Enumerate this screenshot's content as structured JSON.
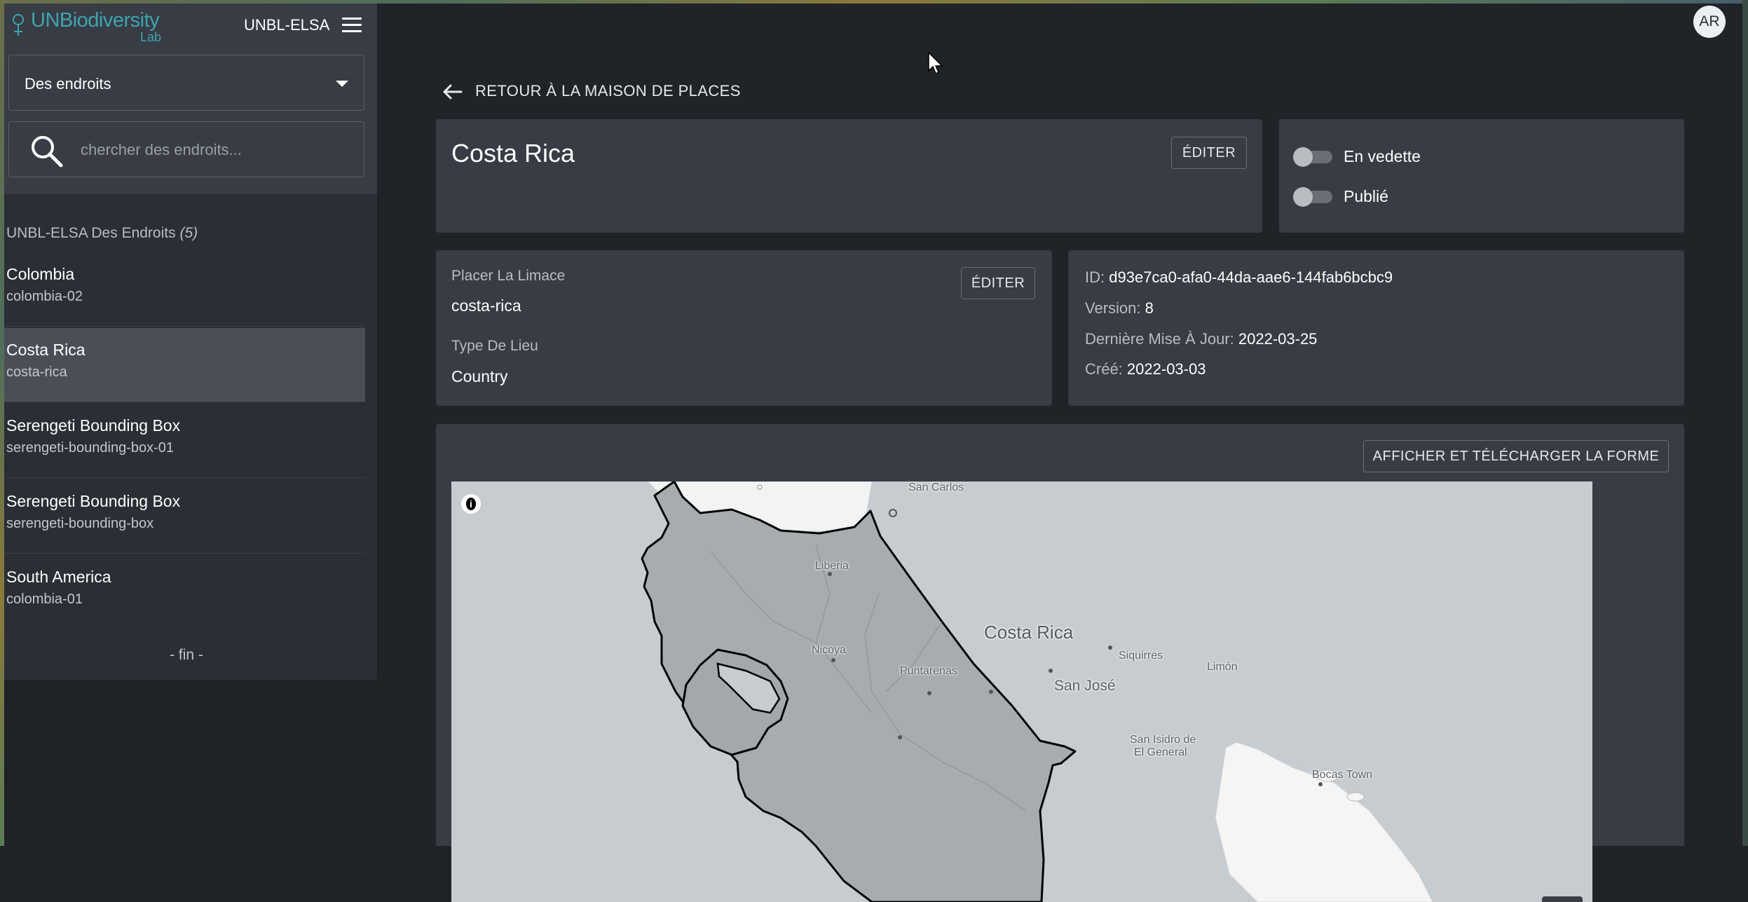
{
  "app": {
    "logo_text": "UNBiodiversity",
    "logo_sub": "Lab",
    "instance_name": "UNBL-ELSA",
    "avatar_initials": "AR",
    "accent_color": "#3fa5b0"
  },
  "sidebar": {
    "select_value": "Des endroits",
    "search_placeholder": "chercher des endroits...",
    "list_title": "UNBL-ELSA Des Endroits",
    "list_count": "(5)",
    "items": [
      {
        "title": "Colombia",
        "slug": "colombia-02",
        "active": false
      },
      {
        "title": "Costa Rica",
        "slug": "costa-rica",
        "active": true
      },
      {
        "title": "Serengeti Bounding Box",
        "slug": "serengeti-bounding-box-01",
        "active": false
      },
      {
        "title": "Serengeti Bounding Box",
        "slug": "serengeti-bounding-box",
        "active": false
      },
      {
        "title": "South America",
        "slug": "colombia-01",
        "active": false
      }
    ],
    "end_label": "- fin -"
  },
  "main": {
    "back_label": "RETOUR À LA MAISON DE PLACES",
    "place_title": "Costa Rica",
    "edit_label": "ÉDITER",
    "toggles": [
      {
        "label": "En vedette",
        "on": false
      },
      {
        "label": "Publié",
        "on": false
      }
    ],
    "slug_label": "Placer La Limace",
    "slug_value": "costa-rica",
    "type_label": "Type De Lieu",
    "type_value": "Country",
    "meta": {
      "id_label": "ID:",
      "id_value": "d93e7ca0-afa0-44da-aae6-144fab6bcbc9",
      "version_label": "Version:",
      "version_value": "8",
      "updated_label": "Dernière Mise À Jour:",
      "updated_value": "2022-03-25",
      "created_label": "Créé:",
      "created_value": "2022-03-03"
    },
    "shape_button": "AFFICHER ET TÉLÉCHARGER LA FORME",
    "map": {
      "country_label": "Costa Rica",
      "capital_label": "San José",
      "places": [
        "San Carlos",
        "Liberia",
        "Nicoya",
        "Puntarenas",
        "Siquirres",
        "Limón",
        "San Isidro de",
        "El General",
        "Bocas Town"
      ],
      "info_icon": "info-icon"
    }
  }
}
